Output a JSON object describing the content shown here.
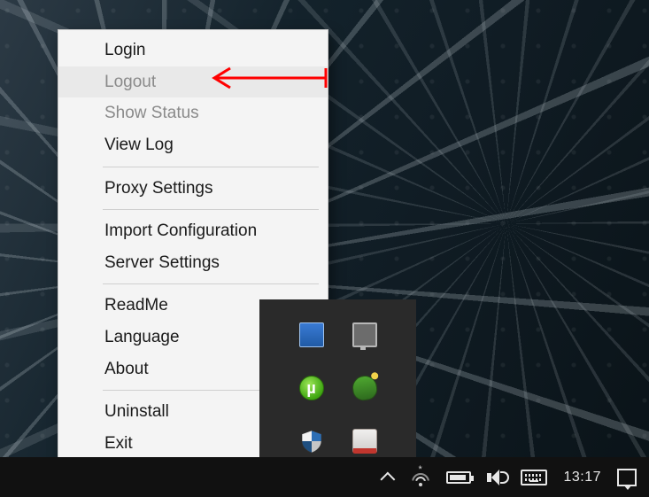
{
  "menu": {
    "items": [
      {
        "label": "Login",
        "enabled": true
      },
      {
        "label": "Logout",
        "enabled": false,
        "hover": true
      },
      {
        "label": "Show Status",
        "enabled": false
      },
      {
        "label": "View Log",
        "enabled": true
      },
      {
        "label": "Proxy Settings",
        "enabled": true
      },
      {
        "label": "Import Configuration",
        "enabled": true
      },
      {
        "label": "Server Settings",
        "enabled": true
      },
      {
        "label": "ReadMe",
        "enabled": true
      },
      {
        "label": "Language",
        "enabled": true
      },
      {
        "label": "About",
        "enabled": true
      },
      {
        "label": "Uninstall",
        "enabled": true
      },
      {
        "label": "Exit",
        "enabled": true
      }
    ]
  },
  "annotation": {
    "arrow_color": "#ff0000",
    "points_to": "Logout"
  },
  "tray_popup": {
    "icons": [
      {
        "name": "intel-graphics-icon"
      },
      {
        "name": "display-icon"
      },
      {
        "name": "utorrent-icon",
        "glyph": "µ"
      },
      {
        "name": "idm-icon"
      },
      {
        "name": "shield-icon"
      },
      {
        "name": "red-app-icon"
      }
    ]
  },
  "taskbar": {
    "clock": "13:17",
    "wifi_extra": "*"
  }
}
